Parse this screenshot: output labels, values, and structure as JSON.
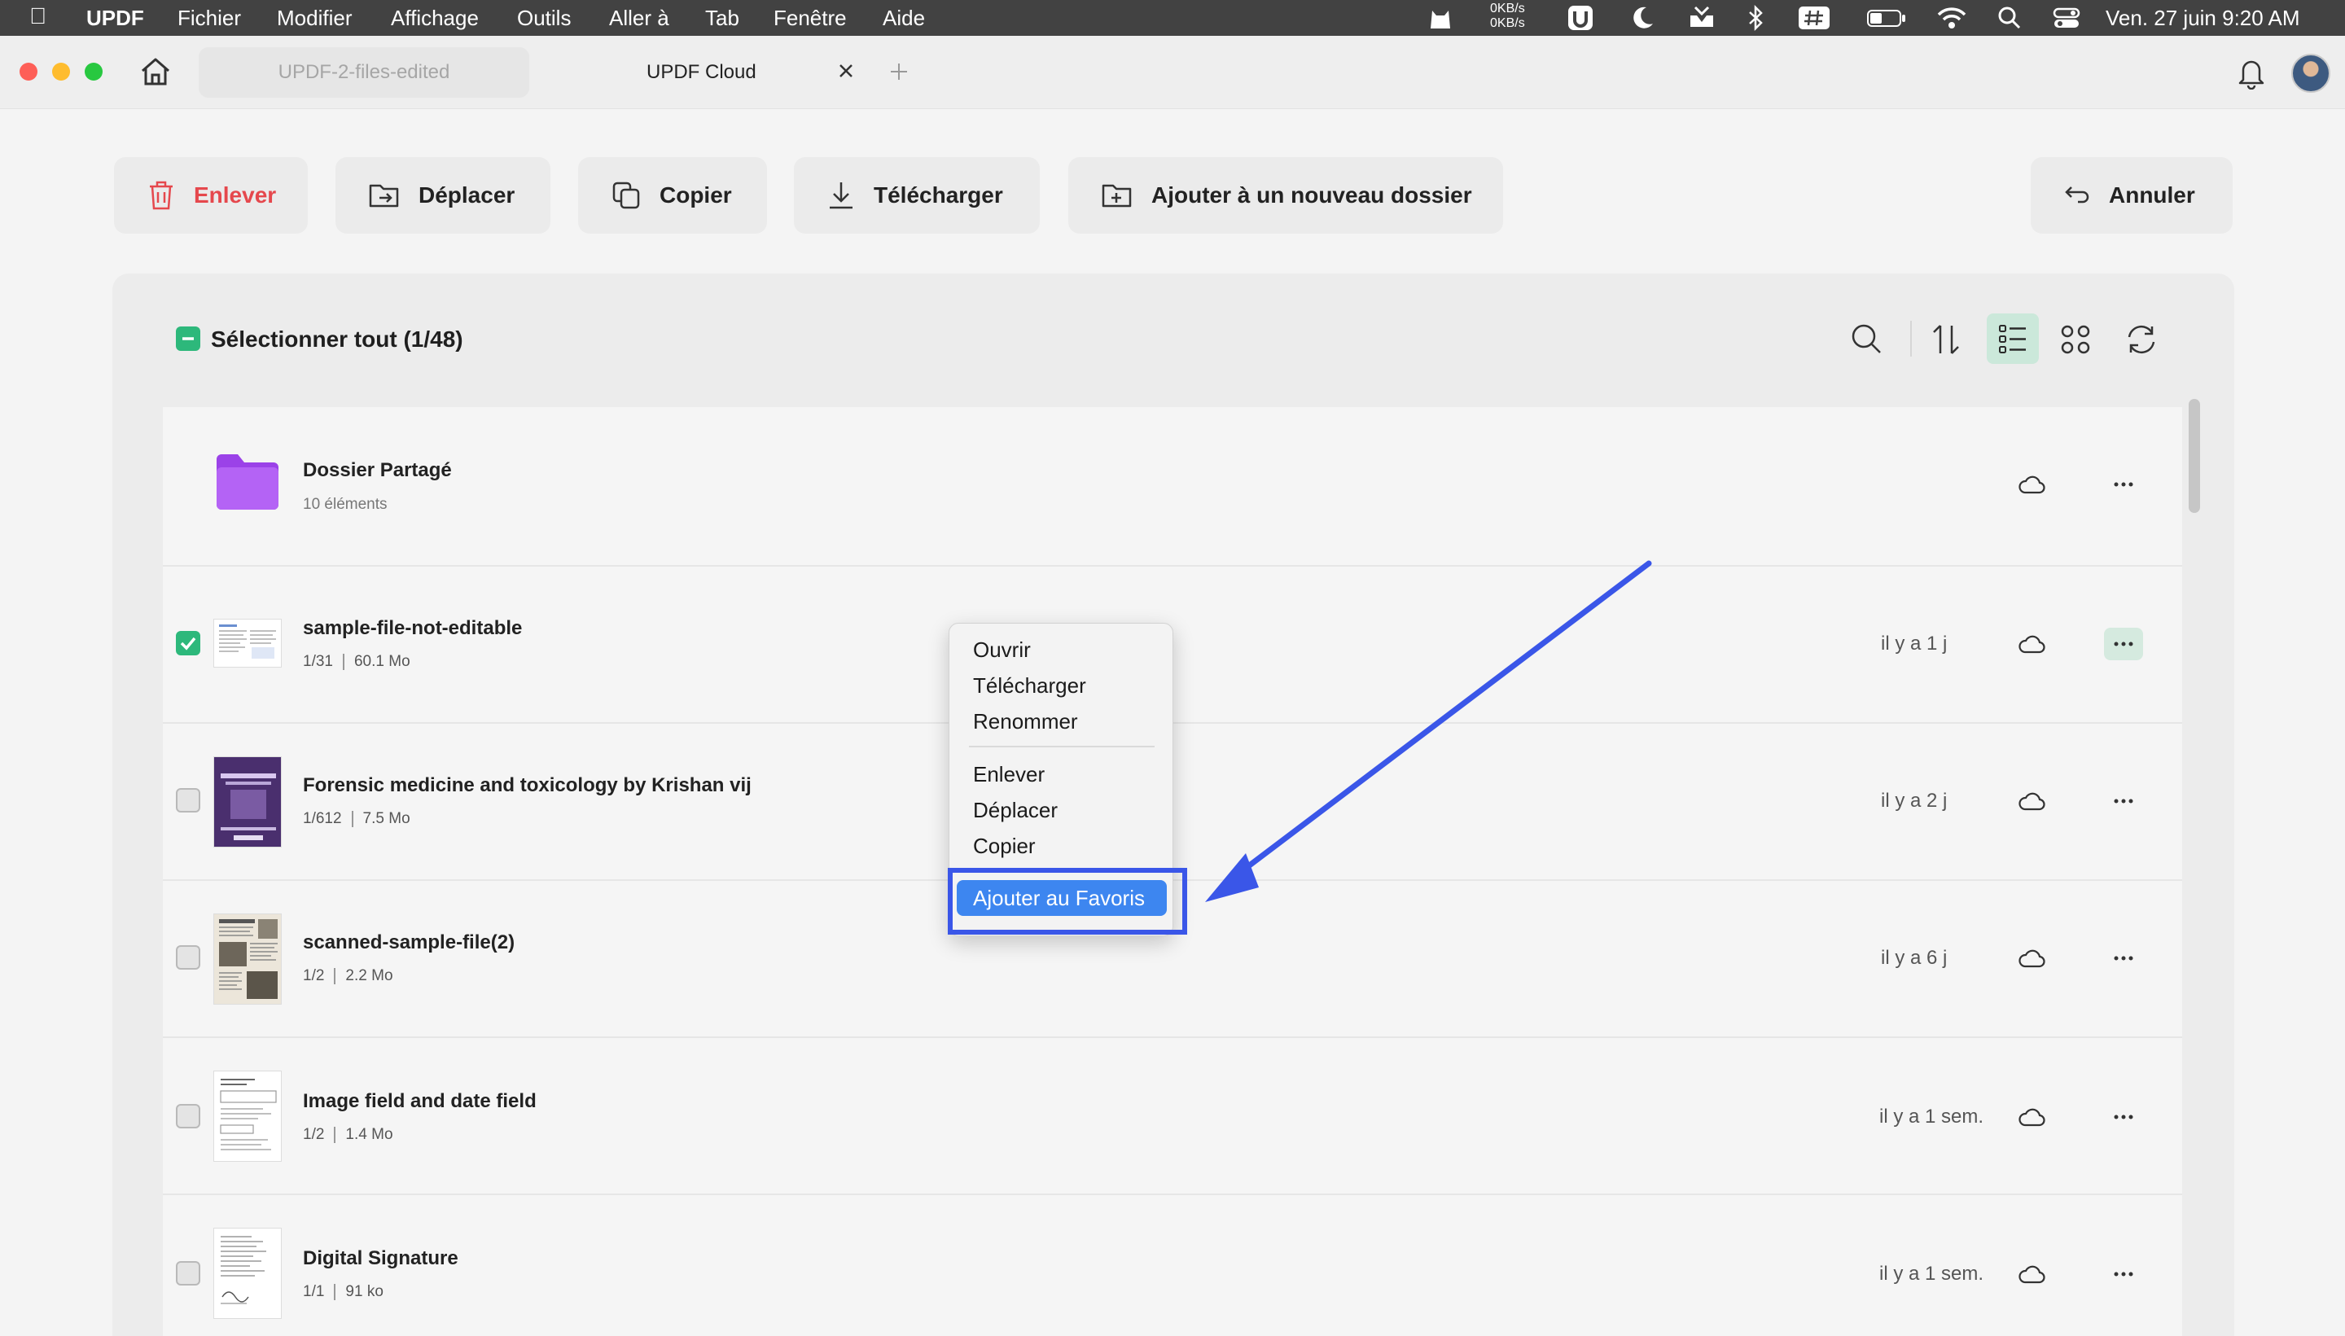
{
  "menubar": {
    "app": "UPDF",
    "items": [
      "Fichier",
      "Modifier",
      "Affichage",
      "Outils",
      "Aller à",
      "Tab",
      "Fenêtre",
      "Aide"
    ],
    "net_up": "0KB/s",
    "net_down": "0KB/s",
    "datetime": "Ven. 27 juin  9:20 AM"
  },
  "tabs": [
    {
      "label": "UPDF-2-files-edited"
    },
    {
      "label": "UPDF Cloud"
    }
  ],
  "toolbar": {
    "remove": "Enlever",
    "move": "Déplacer",
    "copy": "Copier",
    "download": "Télécharger",
    "add_folder": "Ajouter à un nouveau dossier",
    "cancel": "Annuler"
  },
  "select_all": "Sélectionner tout (1/48)",
  "folder": {
    "name": "Dossier Partagé",
    "count": "10 éléments"
  },
  "files": [
    {
      "name": "sample-file-not-editable",
      "pages": "1/31",
      "size": "60.1 Mo",
      "date": "il y a 1 j",
      "checked": true
    },
    {
      "name": "Forensic medicine and toxicology  by Krishan vij",
      "pages": "1/612",
      "size": "7.5 Mo",
      "date": "il y a 2 j",
      "checked": false
    },
    {
      "name": "scanned-sample-file(2)",
      "pages": "1/2",
      "size": "2.2 Mo",
      "date": "il y a 6 j",
      "checked": false
    },
    {
      "name": "Image field and date field",
      "pages": "1/2",
      "size": "1.4 Mo",
      "date": "il y a 1 sem.",
      "checked": false
    },
    {
      "name": "Digital Signature",
      "pages": "1/1",
      "size": "91 ko",
      "date": "il y a 1 sem.",
      "checked": false
    }
  ],
  "context_menu": {
    "open": "Ouvrir",
    "download": "Télécharger",
    "rename": "Renommer",
    "remove": "Enlever",
    "move": "Déplacer",
    "copy": "Copier",
    "favorite": "Ajouter au Favoris"
  },
  "colors": {
    "accent_green": "#2db87b",
    "danger_red": "#e5484d",
    "folder_purple": "#9b42e8",
    "highlight_blue": "#3a56e8",
    "menu_selection": "#3d86f0"
  }
}
